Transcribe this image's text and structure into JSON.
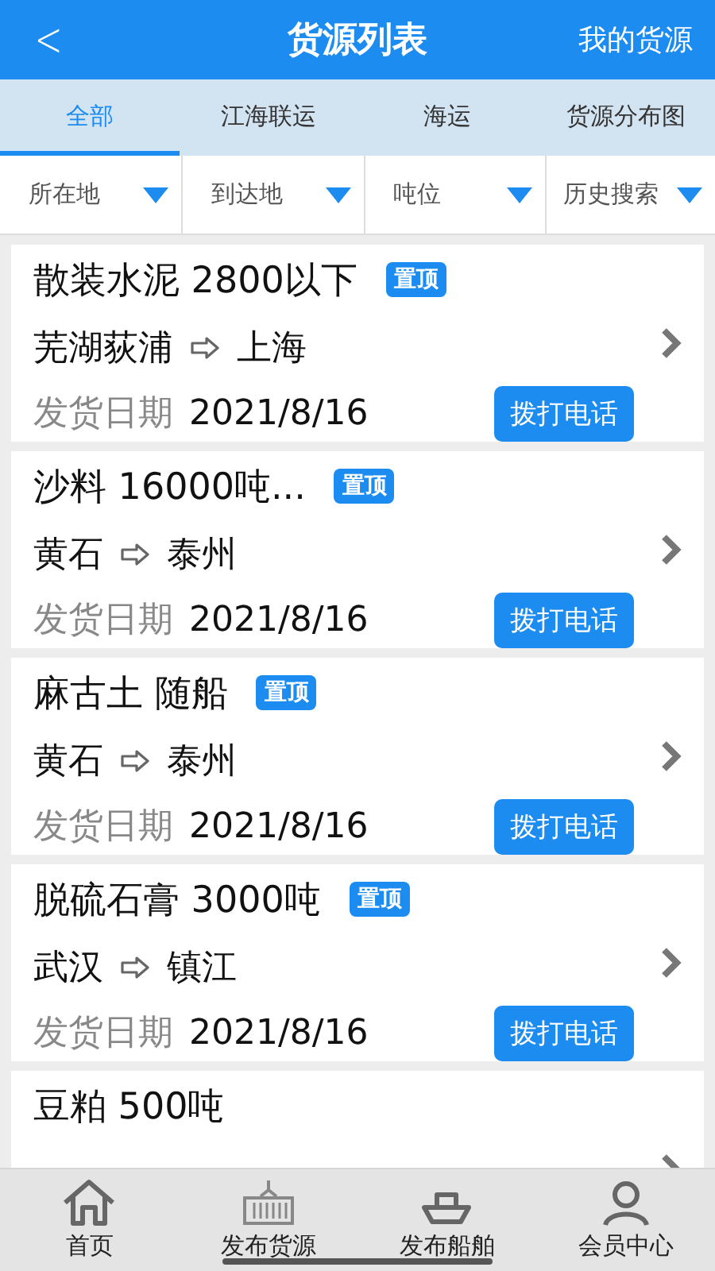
{
  "header": {
    "back": "<",
    "title": "货源列表",
    "action": "我的货源"
  },
  "tabs": [
    {
      "label": "全部",
      "selected": true
    },
    {
      "label": "江海联运",
      "selected": false
    },
    {
      "label": "海运",
      "selected": false
    },
    {
      "label": "货源分布图",
      "selected": false
    }
  ],
  "filters": [
    "所在地",
    "到达地",
    "吨位",
    "历史搜索"
  ],
  "cargo": [
    {
      "title": "散装水泥 2800以下",
      "badge": "置顶",
      "from": "芜湖荻浦",
      "to": "上海",
      "date_label": "发货日期",
      "date": "2021/8/16",
      "call": "拨打电话"
    },
    {
      "title": "沙料 16000吨...",
      "badge": "置顶",
      "from": "黄石",
      "to": "泰州",
      "date_label": "发货日期",
      "date": "2021/8/16",
      "call": "拨打电话"
    },
    {
      "title": "麻古土 随船",
      "badge": "置顶",
      "from": "黄石",
      "to": "泰州",
      "date_label": "发货日期",
      "date": "2021/8/16",
      "call": "拨打电话"
    },
    {
      "title": "脱硫石膏 3000吨",
      "badge": "置顶",
      "from": "武汉",
      "to": "镇江",
      "date_label": "发货日期",
      "date": "2021/8/16",
      "call": "拨打电话"
    },
    {
      "title": "豆粕 500吨"
    }
  ],
  "nav": [
    {
      "kind": "home",
      "label": "首页"
    },
    {
      "kind": "container",
      "label": "发布货源"
    },
    {
      "kind": "ship",
      "label": "发布船舶"
    },
    {
      "kind": "user",
      "label": "会员中心"
    }
  ]
}
